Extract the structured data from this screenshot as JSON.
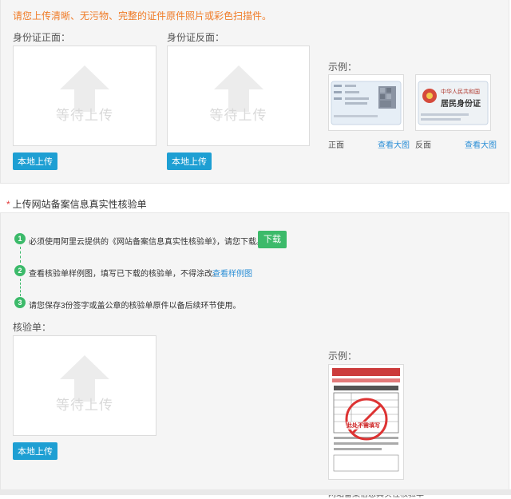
{
  "id_section": {
    "notice": "请您上传清晰、无污物、完整的证件原件照片或彩色扫描件。",
    "front_label": "身份证正面：",
    "back_label": "身份证反面：",
    "placeholder": "等待上传",
    "upload_button": "本地上传",
    "example_label": "示例：",
    "front_caption": "正面",
    "back_caption": "反面",
    "view_large": "查看大图",
    "card_front_text": "中华人民共和国",
    "card_back_title": "居民身份证"
  },
  "verify_section": {
    "title": "上传网站备案信息真实性核验单",
    "required_mark": "*",
    "steps": [
      {
        "num": "1",
        "text": "必须使用阿里云提供的《网站备案信息真实性核验单》，请您下载。",
        "action": "下载"
      },
      {
        "num": "2",
        "text": "查看核验单样例图，填写已下载的核验单，不得涂改。",
        "action": "查看样例图"
      },
      {
        "num": "3",
        "text": "请您保存3份签字或盖公章的核验单原件以备后续环节使用。"
      }
    ],
    "field_label": "核验单：",
    "placeholder": "等待上传",
    "upload_button": "本地上传",
    "example_label": "示例：",
    "example_caption": "网站备案信息真实性核验单",
    "stamp_text": "此处不需填写"
  },
  "colors": {
    "accent_blue": "#1e9fd3",
    "accent_green": "#3cba6a",
    "notice_orange": "#f07c28",
    "required_red": "#e23b3b"
  }
}
